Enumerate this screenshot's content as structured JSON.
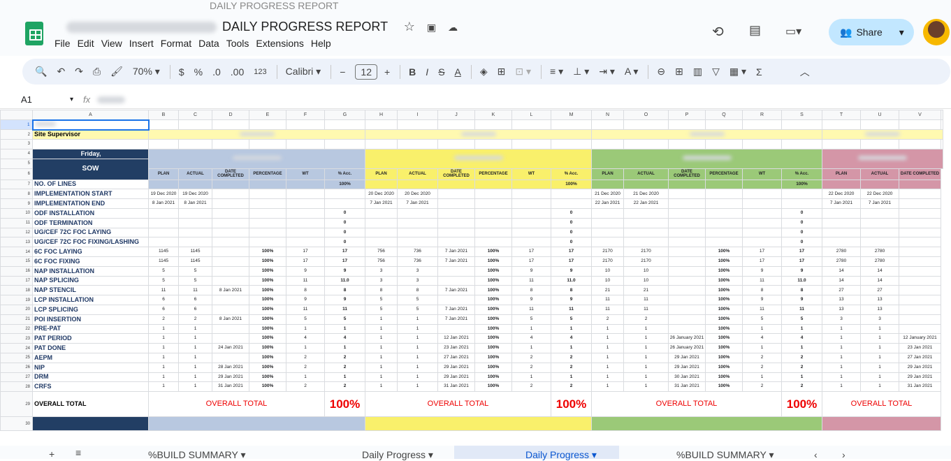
{
  "title": {
    "doc_name": "DAILY PROGRESS REPORT",
    "ghost": "DAILY PROGRESS REPORT"
  },
  "menu": [
    "File",
    "Edit",
    "View",
    "Insert",
    "Format",
    "Data",
    "Tools",
    "Extensions",
    "Help"
  ],
  "share_label": "Share",
  "toolbar": {
    "zoom": "70%",
    "currency": "$",
    "percent": "%",
    "dec_less": ".0",
    "dec_more": ".00",
    "format123": "123",
    "font": "Calibri",
    "font_size": "12"
  },
  "formula": {
    "cell_ref": "A1",
    "fx": "fx"
  },
  "columns": [
    "A",
    "B",
    "C",
    "D",
    "E",
    "F",
    "G",
    "H",
    "I",
    "J",
    "K",
    "L",
    "M",
    "N",
    "O",
    "P",
    "Q",
    "R",
    "S",
    "T",
    "U",
    "V"
  ],
  "labels": {
    "site_supervisor": "Site Supervisor",
    "day": "Friday,",
    "sow": "SOW",
    "overall_total": "OVERALL TOTAL",
    "overall_pct": "100%"
  },
  "sub_headers": [
    "PLAN",
    "ACTUAL",
    "DATE COMPLETED",
    "PERCENTAGE",
    "WT",
    "% Acc."
  ],
  "pct_100": "100%",
  "rows": [
    {
      "n": "7",
      "a": "NO. OF LINES",
      "g": [
        [
          "",
          "",
          "",
          "",
          "",
          ""
        ],
        [
          "",
          "",
          "",
          "",
          "",
          ""
        ],
        [
          "",
          "",
          "",
          "",
          "",
          ""
        ],
        [
          "",
          "",
          ""
        ]
      ]
    },
    {
      "n": "8",
      "a": "IMPLEMENTATION START",
      "g": [
        [
          "19 Dec 2020",
          "19 Dec 2020",
          "",
          "",
          "",
          ""
        ],
        [
          "20 Dec 2020",
          "20 Dec 2020",
          "",
          "",
          "",
          ""
        ],
        [
          "21 Dec 2020",
          "21 Dec 2020",
          "",
          "",
          "",
          ""
        ],
        [
          "22 Dec 2020",
          "22 Dec 2020",
          ""
        ]
      ]
    },
    {
      "n": "9",
      "a": "IMPLEMENTATION END",
      "g": [
        [
          "8 Jan 2021",
          "8 Jan 2021",
          "",
          "",
          "",
          ""
        ],
        [
          "7 Jan 2021",
          "7 Jan 2021",
          "",
          "",
          "",
          ""
        ],
        [
          "22 Jan 2021",
          "22 Jan 2021",
          "",
          "",
          "",
          ""
        ],
        [
          "7 Jan 2021",
          "7 Jan 2021",
          ""
        ]
      ]
    },
    {
      "n": "10",
      "a": "ODF INSTALLATION",
      "g": [
        [
          "",
          "",
          "",
          "",
          "",
          "0"
        ],
        [
          "",
          "",
          "",
          "",
          "",
          "0"
        ],
        [
          "",
          "",
          "",
          "",
          "",
          "0"
        ],
        [
          "",
          "",
          ""
        ]
      ]
    },
    {
      "n": "11",
      "a": "ODF TERMINATION",
      "g": [
        [
          "",
          "",
          "",
          "",
          "",
          "0"
        ],
        [
          "",
          "",
          "",
          "",
          "",
          "0"
        ],
        [
          "",
          "",
          "",
          "",
          "",
          "0"
        ],
        [
          "",
          "",
          ""
        ]
      ]
    },
    {
      "n": "12",
      "a": "UG/CEF 72C FOC LAYING",
      "g": [
        [
          "",
          "",
          "",
          "",
          "",
          "0"
        ],
        [
          "",
          "",
          "",
          "",
          "",
          "0"
        ],
        [
          "",
          "",
          "",
          "",
          "",
          "0"
        ],
        [
          "",
          "",
          ""
        ]
      ]
    },
    {
      "n": "13",
      "a": "UG/CEF 72C FOC FIXING/LASHING",
      "g": [
        [
          "",
          "",
          "",
          "",
          "",
          "0"
        ],
        [
          "",
          "",
          "",
          "",
          "",
          "0"
        ],
        [
          "",
          "",
          "",
          "",
          "",
          "0"
        ],
        [
          "",
          "",
          ""
        ]
      ]
    },
    {
      "n": "14",
      "a": "6C FOC LAYING",
      "g": [
        [
          "1145",
          "1145",
          "",
          "100%",
          "17",
          "17"
        ],
        [
          "756",
          "736",
          "7 Jan 2021",
          "100%",
          "17",
          "17"
        ],
        [
          "2170",
          "2170",
          "",
          "100%",
          "17",
          "17"
        ],
        [
          "2780",
          "2780",
          ""
        ]
      ]
    },
    {
      "n": "15",
      "a": "6C FOC FIXING",
      "g": [
        [
          "1145",
          "1145",
          "",
          "100%",
          "17",
          "17"
        ],
        [
          "756",
          "736",
          "7 Jan 2021",
          "100%",
          "17",
          "17"
        ],
        [
          "2170",
          "2170",
          "",
          "100%",
          "17",
          "17"
        ],
        [
          "2780",
          "2780",
          ""
        ]
      ]
    },
    {
      "n": "16",
      "a": "NAP INSTALLATION",
      "g": [
        [
          "5",
          "5",
          "",
          "100%",
          "9",
          "9"
        ],
        [
          "3",
          "3",
          "",
          "100%",
          "9",
          "9"
        ],
        [
          "10",
          "10",
          "",
          "100%",
          "9",
          "9"
        ],
        [
          "14",
          "14",
          ""
        ]
      ]
    },
    {
      "n": "17",
      "a": "NAP SPLICING",
      "g": [
        [
          "5",
          "5",
          "",
          "100%",
          "11",
          "11.0"
        ],
        [
          "3",
          "3",
          "",
          "100%",
          "11",
          "11.0"
        ],
        [
          "10",
          "10",
          "",
          "100%",
          "11",
          "11.0"
        ],
        [
          "14",
          "14",
          ""
        ]
      ]
    },
    {
      "n": "18",
      "a": "NAP STENCIL",
      "g": [
        [
          "11",
          "11",
          "8 Jan 2021",
          "100%",
          "8",
          "8"
        ],
        [
          "8",
          "8",
          "7 Jan 2021",
          "100%",
          "8",
          "8"
        ],
        [
          "21",
          "21",
          "",
          "100%",
          "8",
          "8"
        ],
        [
          "27",
          "27",
          ""
        ]
      ]
    },
    {
      "n": "19",
      "a": "LCP INSTALLATION",
      "g": [
        [
          "6",
          "6",
          "",
          "100%",
          "9",
          "9"
        ],
        [
          "5",
          "5",
          "",
          "100%",
          "9",
          "9"
        ],
        [
          "11",
          "11",
          "",
          "100%",
          "9",
          "9"
        ],
        [
          "13",
          "13",
          ""
        ]
      ]
    },
    {
      "n": "20",
      "a": "LCP SPLICING",
      "g": [
        [
          "6",
          "6",
          "",
          "100%",
          "11",
          "11"
        ],
        [
          "5",
          "5",
          "7 Jan 2021",
          "100%",
          "11",
          "11"
        ],
        [
          "11",
          "11",
          "",
          "100%",
          "11",
          "11"
        ],
        [
          "13",
          "13",
          ""
        ]
      ]
    },
    {
      "n": "21",
      "a": "POI INSERTION",
      "g": [
        [
          "2",
          "2",
          "8 Jan 2021",
          "100%",
          "5",
          "5"
        ],
        [
          "1",
          "1",
          "7 Jan 2021",
          "100%",
          "5",
          "5"
        ],
        [
          "2",
          "2",
          "",
          "100%",
          "5",
          "5"
        ],
        [
          "3",
          "3",
          ""
        ]
      ]
    },
    {
      "n": "22",
      "a": "PRE-PAT",
      "g": [
        [
          "1",
          "1",
          "",
          "100%",
          "1",
          "1"
        ],
        [
          "1",
          "1",
          "",
          "100%",
          "1",
          "1"
        ],
        [
          "1",
          "1",
          "",
          "100%",
          "1",
          "1"
        ],
        [
          "1",
          "1",
          ""
        ]
      ]
    },
    {
      "n": "23",
      "a": "PAT PERIOD",
      "g": [
        [
          "1",
          "1",
          "",
          "100%",
          "4",
          "4"
        ],
        [
          "1",
          "1",
          "12 Jan 2021",
          "100%",
          "4",
          "4"
        ],
        [
          "1",
          "1",
          "26 January 2021",
          "100%",
          "4",
          "4"
        ],
        [
          "1",
          "1",
          "12 January 2021"
        ]
      ]
    },
    {
      "n": "24",
      "a": "PAT DONE",
      "g": [
        [
          "1",
          "1",
          "24 Jan 2021",
          "100%",
          "1",
          "1"
        ],
        [
          "1",
          "1",
          "23 Jan 2021",
          "100%",
          "1",
          "1"
        ],
        [
          "1",
          "1",
          "26 January 2021",
          "100%",
          "1",
          "1"
        ],
        [
          "1",
          "1",
          "23 Jan 2021"
        ]
      ]
    },
    {
      "n": "25",
      "a": "AEPM",
      "g": [
        [
          "1",
          "1",
          "",
          "100%",
          "2",
          "2"
        ],
        [
          "1",
          "1",
          "27 Jan 2021",
          "100%",
          "2",
          "2"
        ],
        [
          "1",
          "1",
          "29 Jan 2021",
          "100%",
          "2",
          "2"
        ],
        [
          "1",
          "1",
          "27 Jan 2021"
        ]
      ]
    },
    {
      "n": "26",
      "a": "NIP",
      "g": [
        [
          "1",
          "1",
          "28 Jan 2021",
          "100%",
          "2",
          "2"
        ],
        [
          "1",
          "1",
          "29 Jan 2021",
          "100%",
          "2",
          "2"
        ],
        [
          "1",
          "1",
          "29 Jan 2021",
          "100%",
          "2",
          "2"
        ],
        [
          "1",
          "1",
          "29 Jan 2021"
        ]
      ]
    },
    {
      "n": "27",
      "a": "DRM",
      "g": [
        [
          "1",
          "1",
          "29 Jan 2021",
          "100%",
          "1",
          "1"
        ],
        [
          "1",
          "1",
          "29 Jan 2021",
          "100%",
          "1",
          "1"
        ],
        [
          "1",
          "1",
          "30 Jan 2021",
          "100%",
          "1",
          "1"
        ],
        [
          "1",
          "1",
          "29 Jan 2021"
        ]
      ]
    },
    {
      "n": "28",
      "a": "CRFS",
      "g": [
        [
          "1",
          "1",
          "31 Jan 2021",
          "100%",
          "2",
          "2"
        ],
        [
          "1",
          "1",
          "31 Jan 2021",
          "100%",
          "2",
          "2"
        ],
        [
          "1",
          "1",
          "31 Jan 2021",
          "100%",
          "2",
          "2"
        ],
        [
          "1",
          "1",
          "31 Jan 2021"
        ]
      ]
    }
  ],
  "sheets": [
    "%BUILD SUMMARY",
    "Daily Progress",
    "Daily Progress",
    "%BUILD SUMMARY"
  ],
  "colors": {
    "group1": "#b8c8e0",
    "group2": "#f9f06b",
    "group3": "#9bc978",
    "group4": "#d496a7",
    "navy": "#223e64",
    "selected": "#d3e3fd"
  }
}
